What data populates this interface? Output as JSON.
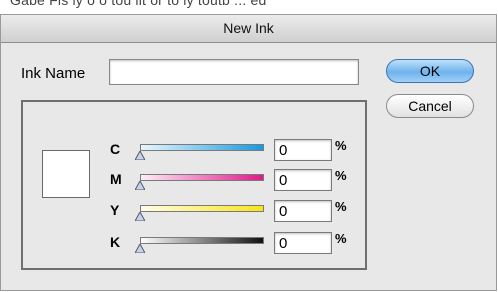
{
  "background_text": "Gabe Fis ly o o tou lit or to ly toutb ... ed",
  "dialog": {
    "title": "New Ink",
    "ink_name": {
      "label": "Ink Name",
      "value": "",
      "placeholder": ""
    },
    "buttons": {
      "ok": "OK",
      "cancel": "Cancel"
    },
    "swatch_color": "#ffffff",
    "channels": [
      {
        "key": "c",
        "label": "C",
        "value": "0",
        "unit": "%",
        "level": 0,
        "gradient": [
          "#e9f6fd",
          "#1799e0"
        ]
      },
      {
        "key": "m",
        "label": "M",
        "value": "0",
        "unit": "%",
        "level": 0,
        "gradient": [
          "#fdeef5",
          "#e0188a"
        ]
      },
      {
        "key": "y",
        "label": "Y",
        "value": "0",
        "unit": "%",
        "level": 0,
        "gradient": [
          "#fffde8",
          "#f8e41a"
        ]
      },
      {
        "key": "k",
        "label": "K",
        "value": "0",
        "unit": "%",
        "level": 0,
        "gradient": [
          "#ffffff",
          "#111111"
        ]
      }
    ]
  }
}
